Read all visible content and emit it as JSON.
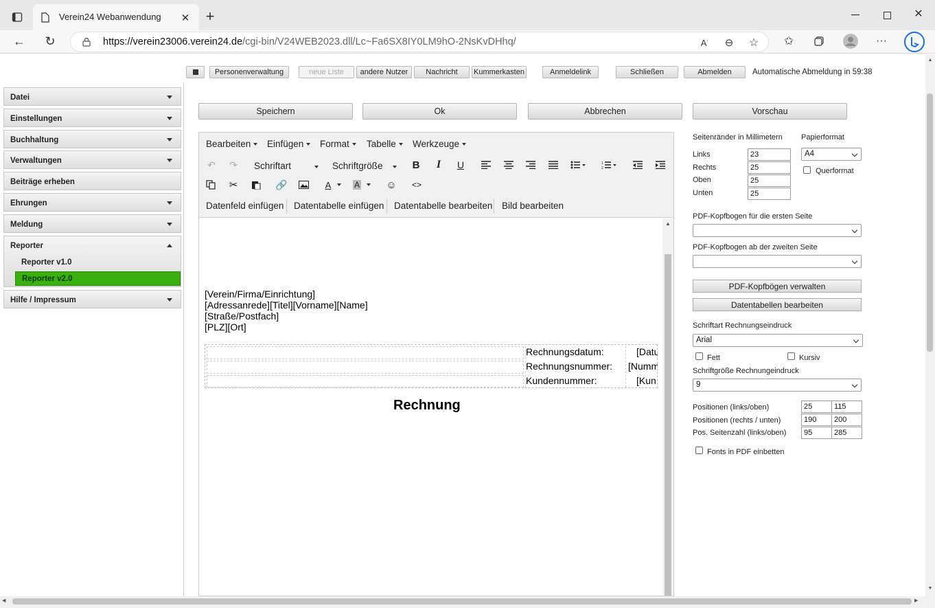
{
  "browser": {
    "tab_title": "Verein24 Webanwendung",
    "url_host": "https://verein23006.verein24.de",
    "url_path": "/cgi-bin/V24WEB2023.dll/Lc~Fa6SX8IY0LM9hO-2NsKvDHhq/"
  },
  "toolbar": {
    "personen": "Personenverwaltung",
    "neue_liste": "neue Liste",
    "andere_nutzer": "andere Nutzer",
    "nachricht": "Nachricht",
    "kummerkasten": "Kummerkasten",
    "anmeldelink": "Anmeldelink",
    "schliessen": "Schließen",
    "abmelden": "Abmelden",
    "auto_logout": "Automatische Abmeldung in 59:38"
  },
  "sidebar": {
    "items": [
      "Datei",
      "Einstellungen",
      "Buchhaltung",
      "Verwaltungen",
      "Beiträge erheben",
      "Ehrungen",
      "Meldung",
      "Reporter",
      "Hilfe / Impressum"
    ],
    "reporter_sub": [
      "Reporter v1.0",
      "Reporter v2.0"
    ]
  },
  "actions": {
    "save": "Speichern",
    "ok": "Ok",
    "cancel": "Abbrechen",
    "preview": "Vorschau"
  },
  "editor": {
    "menus": [
      "Bearbeiten",
      "Einfügen",
      "Format",
      "Tabelle",
      "Werkzeuge"
    ],
    "font_family": "Schriftart",
    "font_size": "Schriftgröße",
    "custom_buttons": [
      "Datenfeld einfügen",
      "Datentabelle einfügen",
      "Datentabelle bearbeiten",
      "Bild bearbeiten"
    ],
    "address_lines": [
      "[Verein/Firma/Einrichtung]",
      "[Adressanrede][Titel][Vorname][Name]",
      "[Straße/Postfach]",
      "[PLZ][Ort]"
    ],
    "info_rows": [
      {
        "label": "Rechnungsdatum:",
        "value": "[Datu"
      },
      {
        "label": "Rechnungsnummer:",
        "value": "[Numm"
      },
      {
        "label": "Kundennummer:",
        "value": "[Kun"
      }
    ],
    "heading": "Rechnung"
  },
  "settings": {
    "margins_title": "Seitenränder in Millimetern",
    "margins": [
      {
        "label": "Links",
        "value": "23"
      },
      {
        "label": "Rechts",
        "value": "25"
      },
      {
        "label": "Oben",
        "value": "25"
      },
      {
        "label": "Unten",
        "value": "25"
      }
    ],
    "paper_title": "Papierformat",
    "paper_value": "A4",
    "landscape_label": "Querformat",
    "pdf_first_label": "PDF-Kopfbogen für die ersten Seite",
    "pdf_first_value": "",
    "pdf_second_label": "PDF-Kopfbogen ab der zweiten Seite",
    "pdf_second_value": "",
    "manage_pdf": "PDF-Kopfbögen verwalten",
    "edit_tables": "Datentabellen bearbeiten",
    "invoice_font_label": "Schriftart Rechnungseindruck",
    "invoice_font_value": "Arial",
    "bold_label": "Fett",
    "italic_label": "Kursiv",
    "invoice_size_label": "Schriftgröße Rechnungeindruck",
    "invoice_size_value": "9",
    "positions": [
      {
        "label": "Positionen (links/oben)",
        "a": "25",
        "b": "115"
      },
      {
        "label": "Positionen (rechts / unten)",
        "a": "190",
        "b": "200"
      },
      {
        "label": "Pos. Seitenzahl (links/oben)",
        "a": "95",
        "b": "285"
      }
    ],
    "embed_fonts_label": "Fonts in PDF einbetten"
  }
}
